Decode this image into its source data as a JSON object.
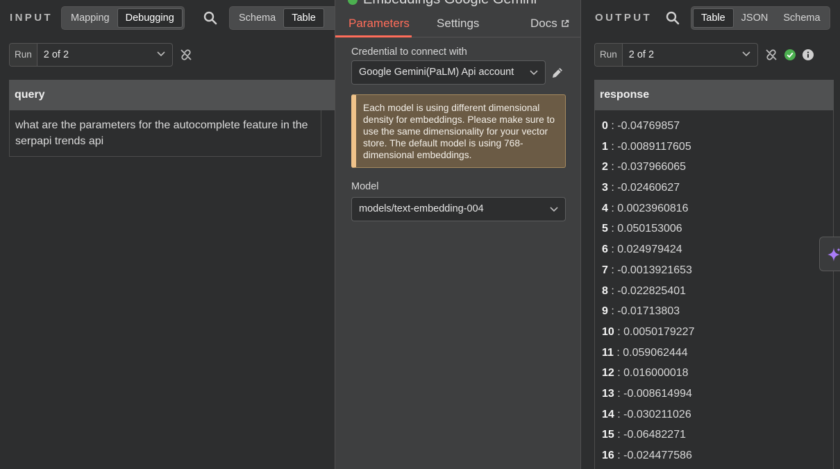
{
  "input": {
    "title": "INPUT",
    "mode_tabs": [
      {
        "label": "Mapping"
      },
      {
        "label": "Debugging"
      }
    ],
    "view_tabs": [
      {
        "label": "Schema"
      },
      {
        "label": "Table"
      }
    ],
    "run_label": "Run",
    "run_value": "2 of 2",
    "table": {
      "header": "query",
      "value": "what are the parameters for the autocomplete feature in the serpapi trends api"
    }
  },
  "node": {
    "title": "Embeddings Google Gemini",
    "tabs": [
      {
        "label": "Parameters"
      },
      {
        "label": "Settings"
      },
      {
        "label": "Docs"
      }
    ],
    "credential_label": "Credential to connect with",
    "credential_value": "Google Gemini(PaLM) Api account",
    "notice": "Each model is using different dimensional density for embeddings. Please make sure to use the same dimensionality for your vector store. The default model is using 768-dimensional embeddings.",
    "model_label": "Model",
    "model_value": "models/text-embedding-004"
  },
  "output": {
    "title": "OUTPUT",
    "view_tabs": [
      {
        "label": "Table"
      },
      {
        "label": "JSON"
      },
      {
        "label": "Schema"
      }
    ],
    "run_label": "Run",
    "run_value": "2 of 2",
    "response_header": "response",
    "rows": [
      {
        "index": "0",
        "value": "-0.04769857"
      },
      {
        "index": "1",
        "value": "-0.0089117605"
      },
      {
        "index": "2",
        "value": "-0.037966065"
      },
      {
        "index": "3",
        "value": "-0.02460627"
      },
      {
        "index": "4",
        "value": "0.0023960816"
      },
      {
        "index": "5",
        "value": "0.050153006"
      },
      {
        "index": "6",
        "value": "0.024979424"
      },
      {
        "index": "7",
        "value": "-0.0013921653"
      },
      {
        "index": "8",
        "value": "-0.022825401"
      },
      {
        "index": "9",
        "value": "-0.01713803"
      },
      {
        "index": "10",
        "value": "0.0050179227"
      },
      {
        "index": "11",
        "value": "0.059062444"
      },
      {
        "index": "12",
        "value": "0.016000018"
      },
      {
        "index": "13",
        "value": "-0.008614994"
      },
      {
        "index": "14",
        "value": "-0.030211026"
      },
      {
        "index": "15",
        "value": "-0.06482271"
      },
      {
        "index": "16",
        "value": "-0.024477586"
      }
    ]
  },
  "colors": {
    "accent": "#ff6d5a",
    "success": "#4cb050",
    "notice_bg": "#6b5b45",
    "notice_bar": "#f0c38a",
    "ai_purple": "#a97cf8"
  },
  "icons": [
    "search-icon",
    "unlink-icon",
    "chevron-down-icon",
    "pencil-icon",
    "external-link-icon",
    "check-circle-icon",
    "info-icon",
    "sparkle-icon"
  ]
}
